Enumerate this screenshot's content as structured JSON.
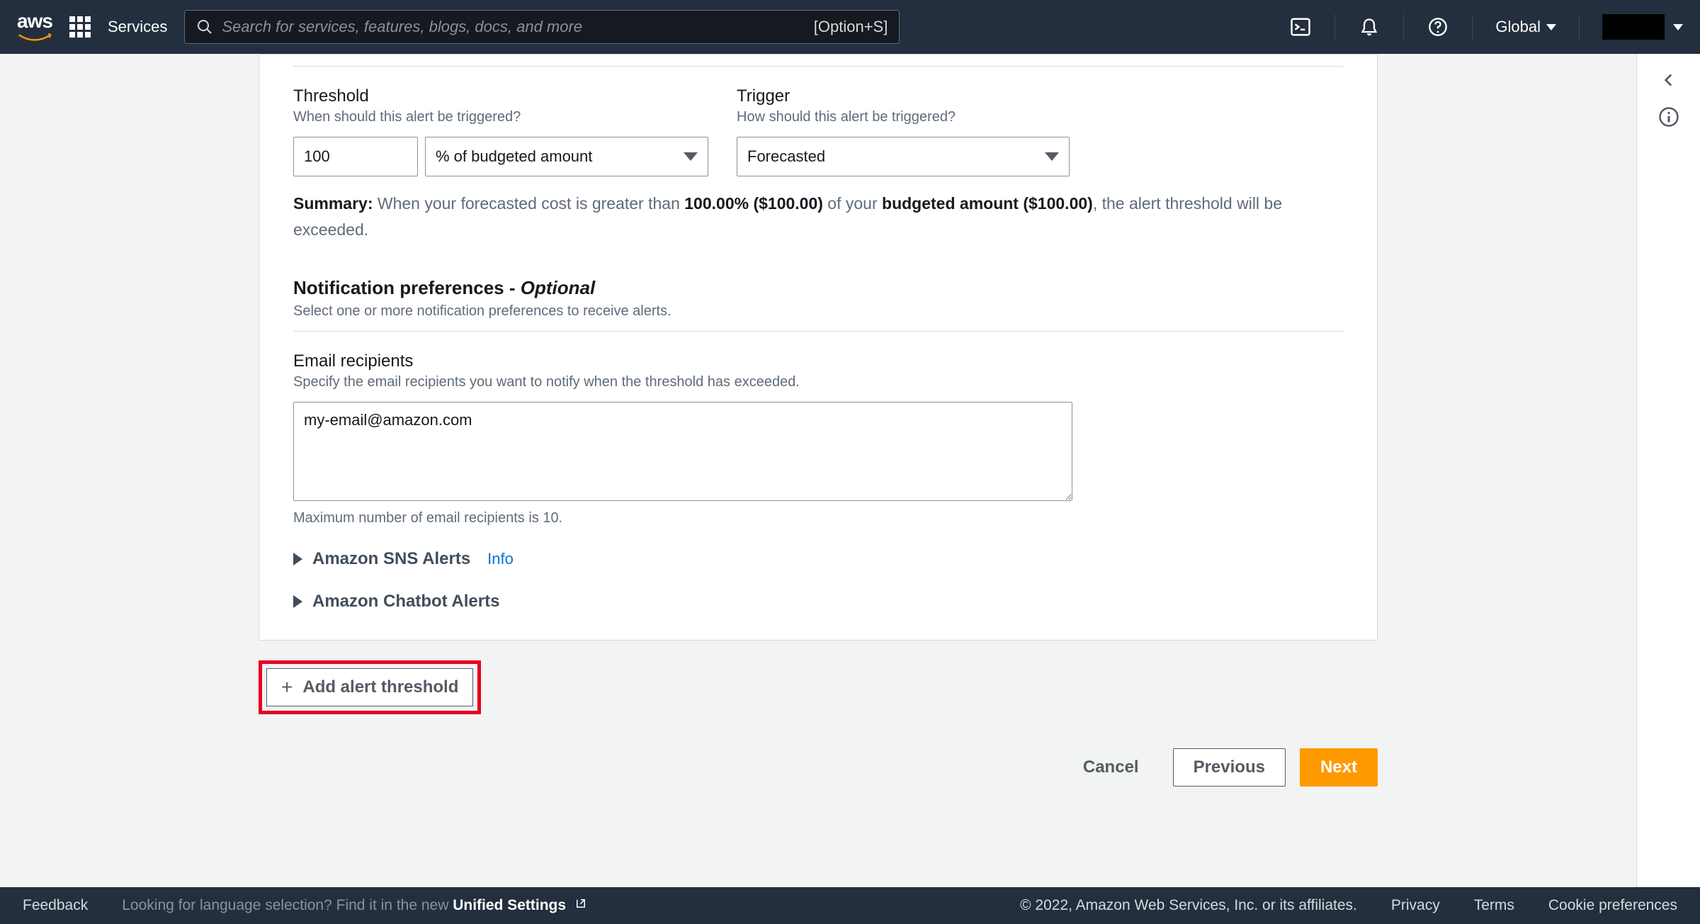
{
  "topnav": {
    "services_label": "Services",
    "search_placeholder": "Search for services, features, blogs, docs, and more",
    "search_shortcut": "[Option+S]",
    "region": "Global"
  },
  "threshold": {
    "label": "Threshold",
    "desc": "When should this alert be triggered?",
    "value": "100",
    "unit": "% of budgeted amount"
  },
  "trigger": {
    "label": "Trigger",
    "desc": "How should this alert be triggered?",
    "value": "Forecasted"
  },
  "summary": {
    "prefix": "Summary:",
    "text1": " When your forecasted cost is greater than ",
    "pct": "100.00% ($100.00)",
    "text2": " of your ",
    "amount": "budgeted amount ($100.00)",
    "text3": ", the alert threshold will be exceeded."
  },
  "notif": {
    "title": "Notification preferences - ",
    "optional": "Optional",
    "desc": "Select one or more notification preferences to receive alerts."
  },
  "email": {
    "label": "Email recipients",
    "desc": "Specify the email recipients you want to notify when the threshold has exceeded.",
    "value": "my-email@amazon.com",
    "hint": "Maximum number of email recipients is 10."
  },
  "sns": {
    "label": "Amazon SNS Alerts",
    "info": "Info"
  },
  "chatbot": {
    "label": "Amazon Chatbot Alerts"
  },
  "add_threshold": "Add alert threshold",
  "actions": {
    "cancel": "Cancel",
    "previous": "Previous",
    "next": "Next"
  },
  "footer": {
    "feedback": "Feedback",
    "lang_q": "Looking for language selection? Find it in the new ",
    "settings": "Unified Settings",
    "copyright": "© 2022, Amazon Web Services, Inc. or its affiliates.",
    "privacy": "Privacy",
    "terms": "Terms",
    "cookies": "Cookie preferences"
  }
}
